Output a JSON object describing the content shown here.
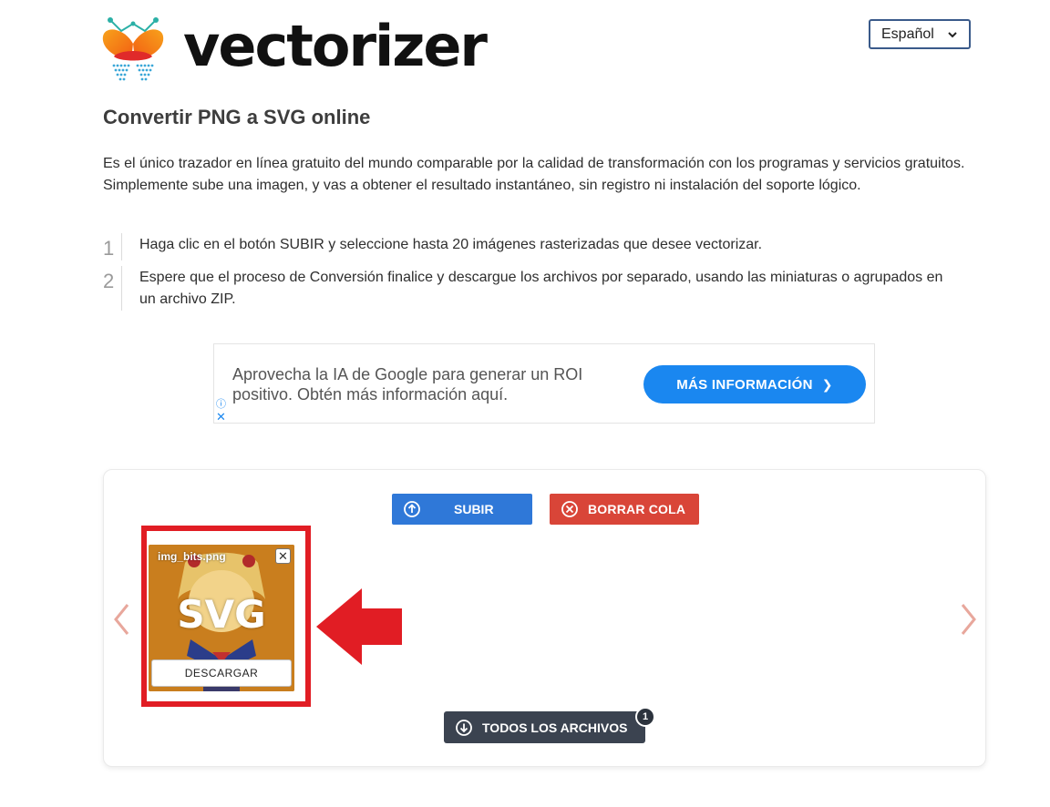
{
  "brand": {
    "name": "vectorizer"
  },
  "language_select": {
    "value": "Español"
  },
  "title": "Convertir PNG a SVG online",
  "intro": "Es el único trazador en línea gratuito del mundo comparable por la calidad de transformación con los programas y servicios gratuitos. Simplemente sube una imagen, y vas a obtener el resultado instantáneo, sin registro ni instalación del soporte lógico.",
  "steps": [
    {
      "num": "1",
      "text": "Haga clic en el botón SUBIR y seleccione hasta 20 imágenes rasterizadas que desee vectorizar."
    },
    {
      "num": "2",
      "text": "Espere que el proceso de Conversión finalice y descargue los archivos por separado, usando las miniaturas o agrupados en un archivo ZIP."
    }
  ],
  "ad": {
    "text": "Aprovecha la IA de Google para generar un ROI positivo. Obtén más información aquí.",
    "button": "MÁS INFORMACIÓN",
    "info_icon": "info-icon",
    "close_icon": "close-icon"
  },
  "toolbar": {
    "upload_label": "SUBIR",
    "clear_label": "BORRAR COLA"
  },
  "queue": {
    "files": [
      {
        "name": "img_bits.png",
        "format_label": "SVG",
        "download_label": "DESCARGAR"
      }
    ],
    "all_files_label": "TODOS LOS ARCHIVOS",
    "count": "1"
  },
  "colors": {
    "upload": "#2f78d8",
    "clear": "#d94538",
    "ad_button": "#1a87f0",
    "all_files": "#3b4350",
    "highlight": "#e11d24",
    "nav_arrow": "#e8a79c"
  }
}
